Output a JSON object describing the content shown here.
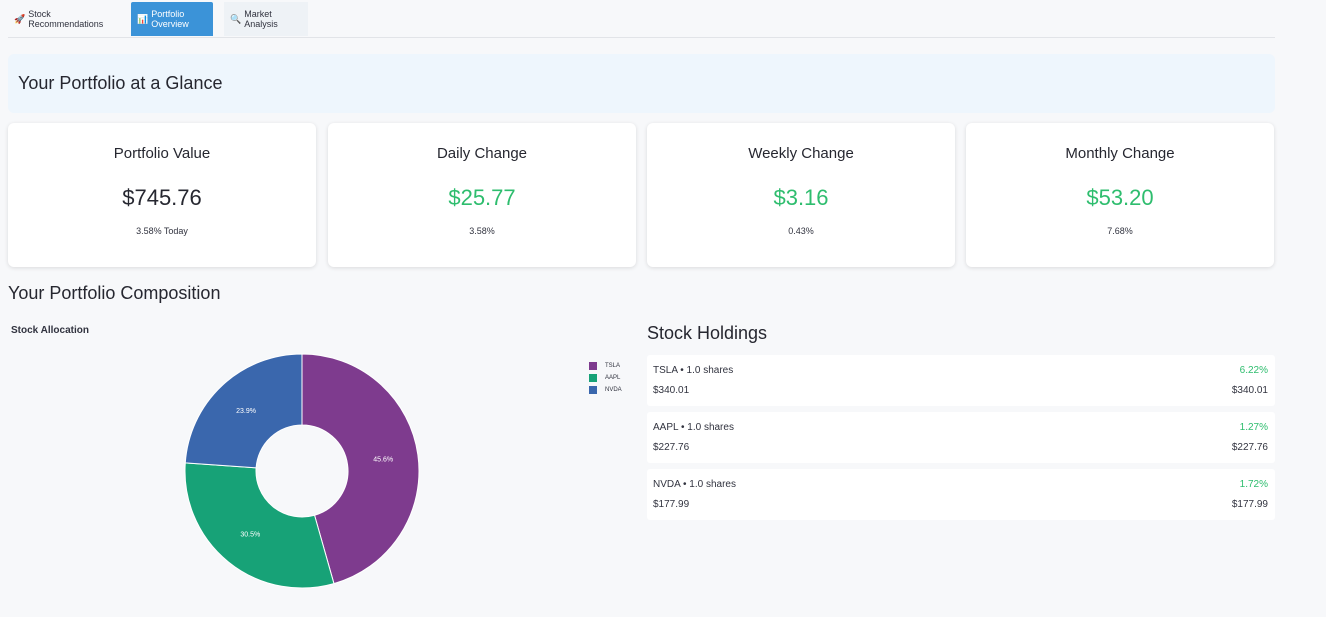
{
  "tabs": [
    {
      "icon": "🚀",
      "label": "Stock Recommendations"
    },
    {
      "icon": "📊",
      "label": "Portfolio Overview"
    },
    {
      "icon": "🔍",
      "label": "Market Analysis"
    }
  ],
  "banner": {
    "title": "Your Portfolio at a Glance"
  },
  "cards": [
    {
      "title": "Portfolio Value",
      "value": "$745.76",
      "sub": "3.58% Today"
    },
    {
      "title": "Daily Change",
      "value": "$25.77",
      "sub": "3.58%"
    },
    {
      "title": "Weekly Change",
      "value": "$3.16",
      "sub": "0.43%"
    },
    {
      "title": "Monthly Change",
      "value": "$53.20",
      "sub": "7.68%"
    }
  ],
  "composition": {
    "title": "Your Portfolio Composition"
  },
  "chart_data": {
    "type": "pie",
    "title": "Stock Allocation",
    "categories": [
      "TSLA",
      "AAPL",
      "NVDA"
    ],
    "values": [
      45.6,
      30.5,
      23.9
    ],
    "labels": [
      "45.6%",
      "30.5%",
      "23.9%"
    ],
    "colors": [
      "#7e3b8e",
      "#17a277",
      "#3a67ad"
    ],
    "legend": "right",
    "hole": true
  },
  "holdings": {
    "title": "Stock Holdings",
    "rows": [
      {
        "symbol": "TSLA • 1.0 shares",
        "pct": "6.22%",
        "price": "$340.01",
        "value": "$340.01"
      },
      {
        "symbol": "AAPL • 1.0 shares",
        "pct": "1.27%",
        "price": "$227.76",
        "value": "$227.76"
      },
      {
        "symbol": "NVDA • 1.0 shares",
        "pct": "1.72%",
        "price": "$177.99",
        "value": "$177.99"
      }
    ]
  }
}
